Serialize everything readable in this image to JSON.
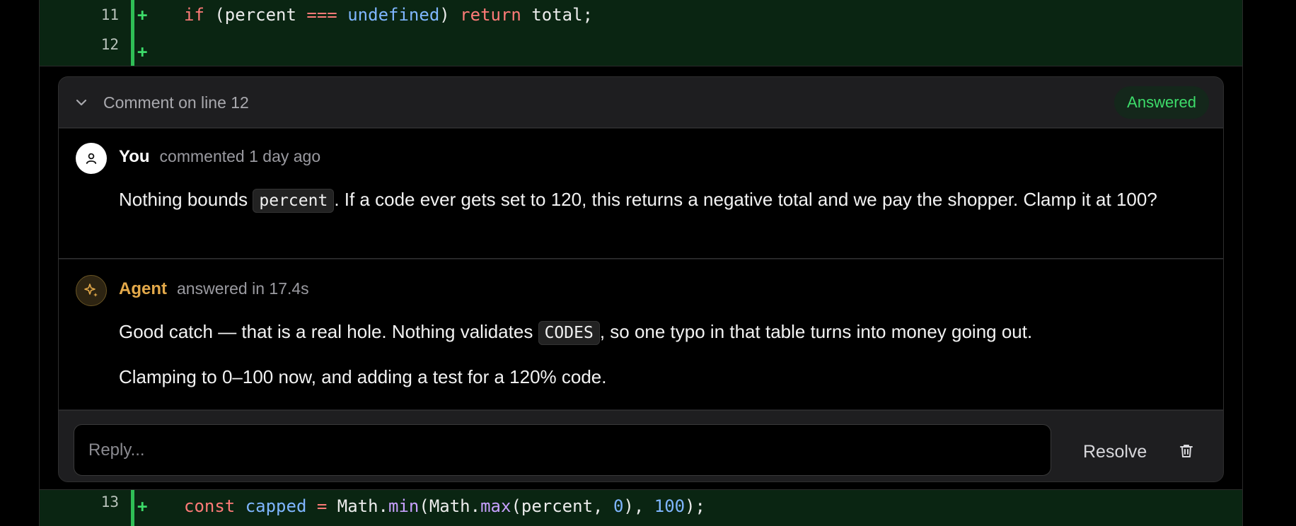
{
  "diff_lines": [
    {
      "number": "11",
      "marker": "+"
    },
    {
      "number": "12",
      "marker": "+"
    },
    {
      "number": "13",
      "marker": "+"
    }
  ],
  "code": {
    "line11": {
      "t1": "if",
      "t2": " (percent ",
      "t3": "===",
      "t4": " ",
      "t5": "undefined",
      "t6": ") ",
      "t7": "return",
      "t8": " total;"
    },
    "line13": {
      "t1": "const",
      "t2": " ",
      "t3": "capped",
      "t4": " ",
      "t5": "=",
      "t6": " Math.",
      "t7": "min",
      "t8": "(Math.",
      "t9": "max",
      "t10": "(percent, ",
      "t11": "0",
      "t12": "), ",
      "t13": "100",
      "t14": ");"
    }
  },
  "thread": {
    "title": "Comment on line 12",
    "status": "Answered",
    "status_color": "#3ddc6a"
  },
  "comments": [
    {
      "author": "You",
      "meta": "commented 1 day ago",
      "icon": "user-icon",
      "body": {
        "a": "Nothing bounds ",
        "code": "percent",
        "b": ". If a code ever gets set to 120, this returns a negative total and we pay the shopper. Clamp it at 100?"
      }
    },
    {
      "author": "Agent",
      "meta": "answered in 17.4s",
      "icon": "sparkle-icon",
      "author_color": "#e3a94a",
      "p1": {
        "a": "Good catch — that is a real hole. Nothing validates ",
        "code": "CODES",
        "b": ", so one typo in that table turns into money going out."
      },
      "p2": "Clamping to 0–100 now, and adding a test for a 120% code."
    }
  ],
  "reply": {
    "placeholder": "Reply...",
    "resolve_label": "Resolve",
    "delete_icon": "trash-icon"
  }
}
